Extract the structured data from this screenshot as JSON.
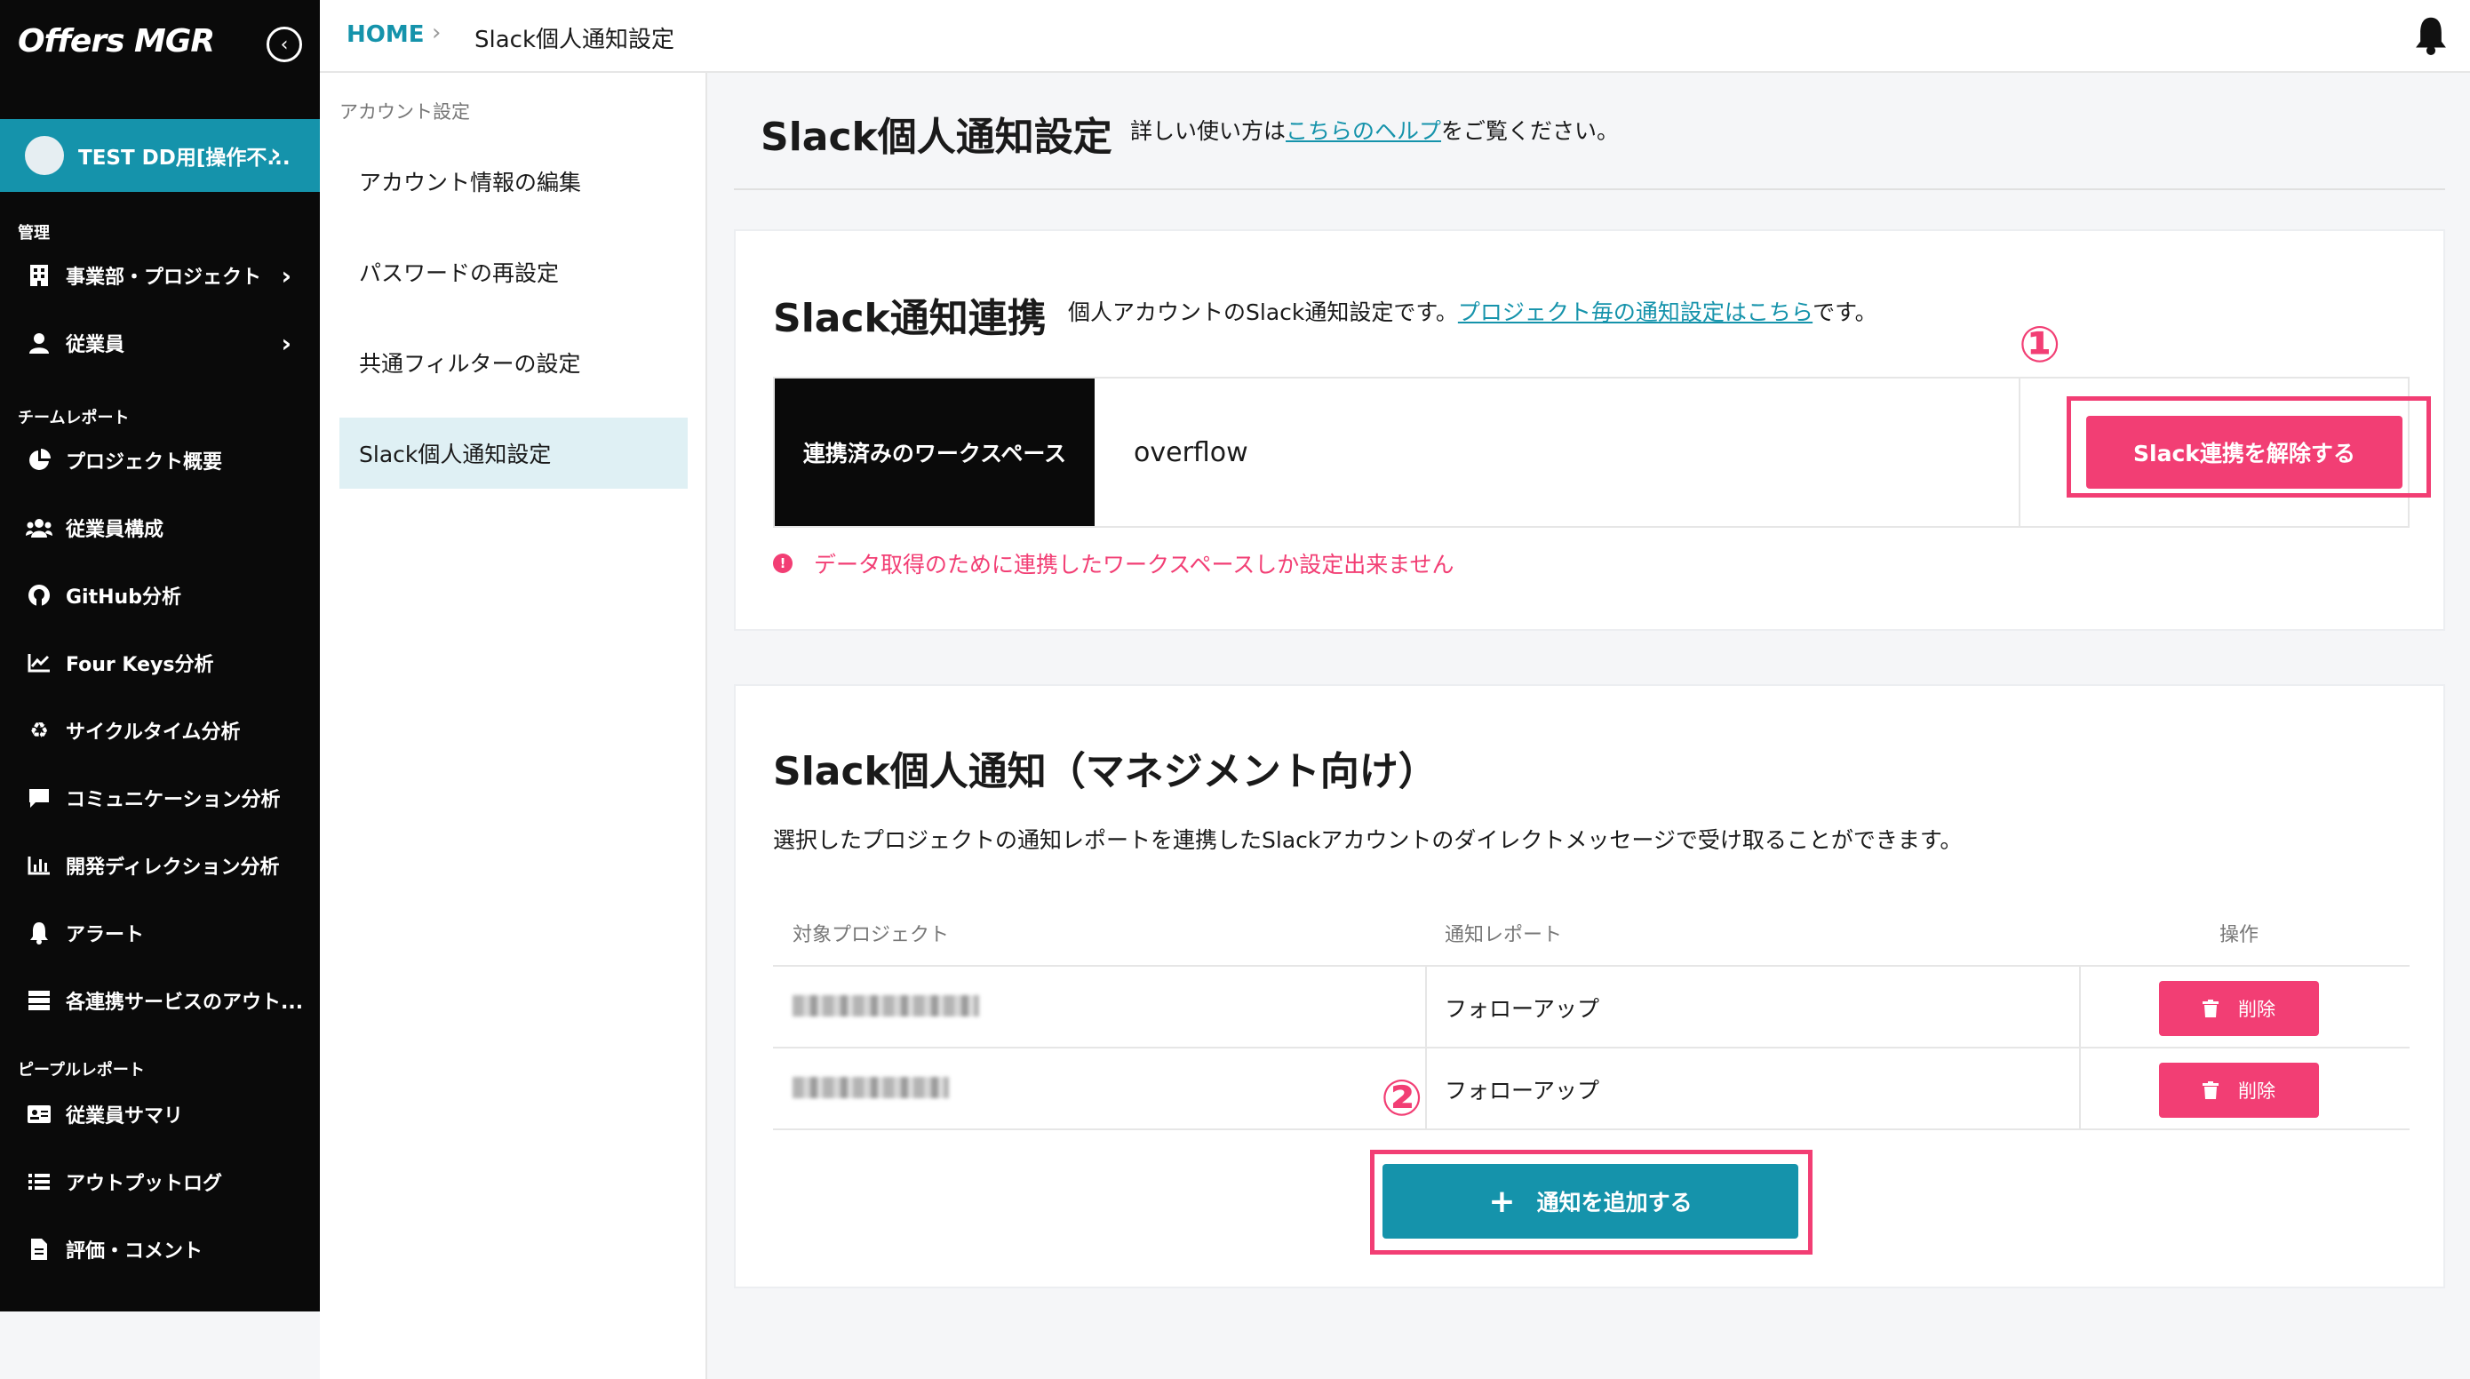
{
  "app": {
    "logo": "Offers MGR"
  },
  "account": {
    "name": "TEST DD用[操作不..."
  },
  "sidebar": {
    "section_manage": "管理",
    "section_team": "チームレポート",
    "section_people": "ピープルレポート",
    "manage_items": [
      {
        "label": "事業部・プロジェクト",
        "icon": "building-icon"
      },
      {
        "label": "従業員",
        "icon": "user-icon"
      }
    ],
    "team_items": [
      {
        "label": "プロジェクト概要",
        "icon": "pie-chart-icon"
      },
      {
        "label": "従業員構成",
        "icon": "users-icon"
      },
      {
        "label": "GitHub分析",
        "icon": "github-icon"
      },
      {
        "label": "Four Keys分析",
        "icon": "line-chart-icon"
      },
      {
        "label": "サイクルタイム分析",
        "icon": "recycle-icon"
      },
      {
        "label": "コミュニケーション分析",
        "icon": "chat-icon"
      },
      {
        "label": "開発ディレクション分析",
        "icon": "bar-chart-icon"
      },
      {
        "label": "アラート",
        "icon": "bell-icon"
      },
      {
        "label": "各連携サービスのアウト...",
        "icon": "server-icon"
      }
    ],
    "people_items": [
      {
        "label": "従業員サマリ",
        "icon": "id-card-icon"
      },
      {
        "label": "アウトプットログ",
        "icon": "list-icon"
      },
      {
        "label": "評価・コメント",
        "icon": "document-icon"
      }
    ]
  },
  "breadcrumb": {
    "home": "HOME",
    "separator": "›",
    "current": "Slack個人通知設定"
  },
  "subnav": {
    "title": "アカウント設定",
    "items": [
      "アカウント情報の編集",
      "パスワードの再設定",
      "共通フィルターの設定",
      "Slack個人通知設定"
    ],
    "active_index": 3
  },
  "page": {
    "title": "Slack個人通知設定",
    "desc_prefix": "詳しい使い方は",
    "desc_link": "こちらのヘルプ",
    "desc_suffix": "をご覧ください。"
  },
  "slack_link": {
    "title": "Slack通知連携",
    "desc_prefix": "個人アカウントのSlack通知設定です。",
    "desc_link": "プロジェクト毎の通知設定はこちら",
    "desc_suffix": "です。",
    "workspace_label": "連携済みのワークスペース",
    "workspace_value": "overflow",
    "unlink_button": "Slack連携を解除する",
    "warning": "データ取得のために連携したワークスペースしか設定出来ません",
    "badge": "①"
  },
  "management": {
    "title": "Slack個人通知（マネジメント向け）",
    "desc": "選択したプロジェクトの通知レポートを連携したSlackアカウントのダイレクトメッセージで受け取ることができます。",
    "columns": [
      "対象プロジェクト",
      "通知レポート",
      "操作"
    ],
    "rows": [
      {
        "report": "フォローアップ",
        "action": "削除"
      },
      {
        "report": "フォローアップ",
        "action": "削除"
      }
    ],
    "add_button": "通知を追加する",
    "badge": "②"
  },
  "colors": {
    "accent": "#1593ab",
    "danger": "#f23e74",
    "sidebar_bg": "#0a0a0a"
  }
}
